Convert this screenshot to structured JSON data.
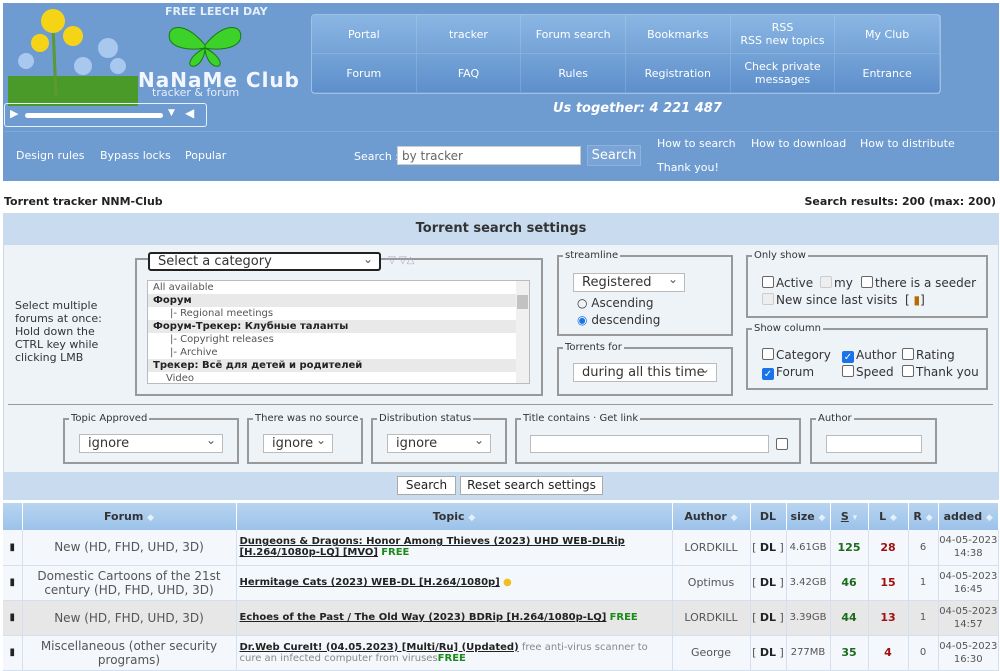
{
  "header": {
    "free_leech": "FREE LEECH DAY",
    "logo_name": "NaNaMe Club",
    "logo_sub": "tracker & forum",
    "together": "Us together: 4 221 487"
  },
  "nav": [
    "Portal",
    "tracker",
    "Forum search",
    "Bookmarks",
    "RSS\nRSS new topics",
    "My Club",
    "Forum",
    "FAQ",
    "Rules",
    "Registration",
    "Check private messages",
    "Entrance"
  ],
  "sublinks": {
    "design": "Design rules",
    "bypass": "Bypass locks",
    "popular": "Popular",
    "search_label": "Search :",
    "search_placeholder": "by tracker",
    "search_button": "Search",
    "how_search": "How to search",
    "how_download": "How to download",
    "how_distribute": "How to distribute",
    "thanks": "Thank you!"
  },
  "page": {
    "title": "Torrent tracker NNM-Club",
    "results": "Search results: 200 (max: 200)"
  },
  "settings": {
    "title": "Torrent search settings",
    "hint": "Select multiple forums at once:\nHold down the CTRL key while clicking LMB",
    "category_select": "Select a category",
    "categories": [
      {
        "label": "All available",
        "t": "item"
      },
      {
        "label": "Форум",
        "t": "grp"
      },
      {
        "label": "|- Regional meetings",
        "t": "sub"
      },
      {
        "label": "Форум-Трекер: Клубные таланты",
        "t": "grp"
      },
      {
        "label": "|- Copyright releases",
        "t": "sub"
      },
      {
        "label": "|- Archive",
        "t": "sub"
      },
      {
        "label": "Трекер: Всё для детей и родителей",
        "t": "grp"
      },
      {
        "label": "Video",
        "t": "item2"
      }
    ],
    "streamline_legend": "streamline",
    "streamline_value": "Registered",
    "ascending": "Ascending",
    "descending": "descending",
    "order": "descending",
    "torrents_for_legend": "Torrents for",
    "torrents_for_value": "during all this time",
    "only_show_legend": "Only show",
    "active": "Active",
    "my": "my",
    "seeder": "there is a seeder",
    "new_since": "New since last visits",
    "show_column_legend": "Show column",
    "col_category": "Category",
    "col_author": "Author",
    "col_rating": "Rating",
    "col_forum": "Forum",
    "col_speed": "Speed",
    "col_thanks": "Thank you",
    "checked": {
      "active": false,
      "seeder": false,
      "category": false,
      "author": true,
      "rating": false,
      "forum": true,
      "speed": false,
      "thanks": false
    },
    "topic_approved_legend": "Topic Approved",
    "topic_approved": "ignore",
    "no_source_legend": "There was no source",
    "no_source": "ignore",
    "dist_status_legend": "Distribution status",
    "dist_status": "ignore",
    "title_contains_legend": "Title contains · Get link",
    "author_legend": "Author",
    "search_button": "Search",
    "reset_button": "Reset search settings"
  },
  "table": {
    "headers": {
      "forum": "Forum",
      "topic": "Topic",
      "author": "Author",
      "dl": "DL",
      "size": "size",
      "s": "S",
      "l": "L",
      "r": "R",
      "added": "added"
    },
    "rows": [
      {
        "forum": "New (HD, FHD, UHD, 3D)",
        "topic": "Dungeons & Dragons: Honor Among Thieves (2023) UHD WEB-DLRip [H.264/1080p-LQ] [MVO]",
        "free": "FREE",
        "desc": "",
        "author": "LORDKILL",
        "dl": "DL",
        "size": "4.61GB",
        "s": "125",
        "l": "28",
        "r": "6",
        "date": "04-05-2023",
        "time": "14:38"
      },
      {
        "forum": "Domestic Cartoons of the 21st century (HD, FHD, UHD, 3D)",
        "topic": "Hermitage Cats (2023) WEB-DL [H.264/1080p]",
        "free": "",
        "desc": "",
        "author": "Optimus",
        "dl": "DL",
        "size": "3.42GB",
        "s": "46",
        "l": "15",
        "r": "1",
        "date": "04-05-2023",
        "time": "16:45"
      },
      {
        "forum": "New (HD, FHD, UHD, 3D)",
        "topic": "Echoes of the Past / The Old Way (2023) BDRip [H.264/1080p-LQ]",
        "free": "FREE",
        "desc": "",
        "author": "LORDKILL",
        "dl": "DL",
        "size": "3.39GB",
        "s": "44",
        "l": "13",
        "r": "1",
        "date": "04-05-2023",
        "time": "14:57"
      },
      {
        "forum": "Miscellaneous (other security programs)",
        "topic": "Dr.Web CureIt! (04.05.2023) [Multi/Ru] (Updated)",
        "free": "FREE",
        "desc": "free anti-virus scanner to cure an infected computer from viruses",
        "author": "George",
        "dl": "DL",
        "size": "277MB",
        "s": "35",
        "l": "4",
        "r": "0",
        "date": "04-05-2023",
        "time": "16:30"
      }
    ]
  }
}
